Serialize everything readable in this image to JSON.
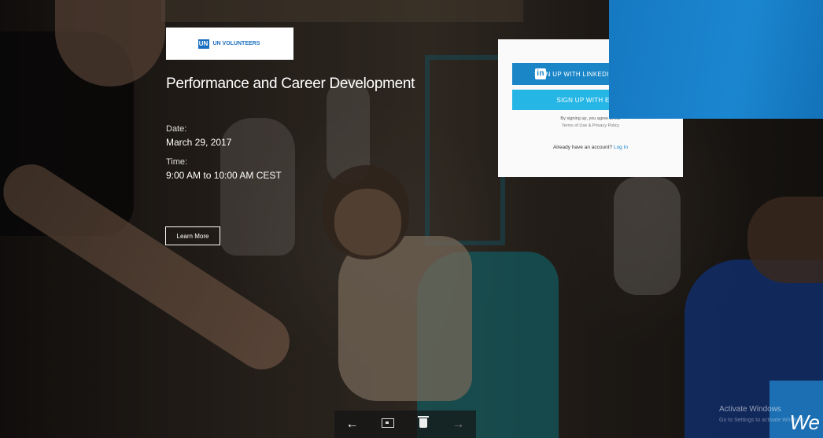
{
  "event": {
    "logo_text": "UN VOLUNTEERS",
    "title": "Performance and Career Development",
    "date_label": "Date:",
    "date_value": "March 29, 2017",
    "time_label": "Time:",
    "time_value": "9:00 AM to 10:00 AM CEST",
    "learn_more": "Learn More"
  },
  "signup": {
    "linkedin_label": "SIGN UP WITH LINKEDIN",
    "email_label": "SIGN UP WITH EMAIL",
    "legal_line1": "By signing up, you agree to our",
    "legal_line2": "Terms of Use & Privacy Policy",
    "already_text": "Already have an account?",
    "login_link": "Log In"
  },
  "toolbar": {
    "back_icon": "←",
    "forward_icon": "→"
  },
  "watermark": {
    "line1": "Activate Windows",
    "line2": "Go to Settings to activate Windows.",
    "tile_text": "We"
  }
}
